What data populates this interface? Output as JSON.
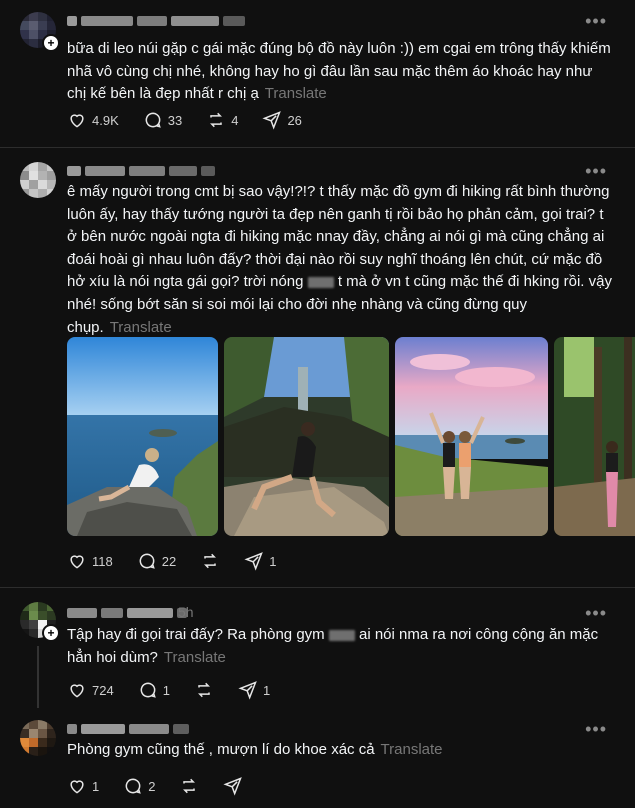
{
  "translate_label": "Translate",
  "posts": [
    {
      "text": "bữa di leo núi gặp c gái mặc đúng bộ đồ này luôn :)) em cgai em trông thấy khiếm nhã vô cùng chị nhé, không hay ho gì đâu lần sau mặc thêm áo khoác hay như chị kế bên là đẹp nhất r chị ạ",
      "likes": "4.9K",
      "comments": "33",
      "reposts": "4",
      "shares": "26"
    },
    {
      "text_part1": "ê mấy người trong cmt bị sao vậy!?!? t thấy mặc đồ gym đi hiking rất bình thường luôn ấy, hay thấy tướng người ta đẹp nên ganh tị rồi bảo họ phản cảm, gọi trai? t ở bên nước ngoài ngta đi hiking mặc nnay đầy, chẳng ai nói gì mà cũng chẳng ai đoái hoài gì nhau luôn đấy? thời đại nào rồi suy nghĩ thoáng lên chút, cứ mặc đồ hở xíu là nói ngta gái gọi? trời nóng",
      "text_part2": "t mà ở vn t cũng mặc thế đi hking rồi. vậy nhé! sống bớt săn si soi mói lại cho đời nhẹ nhàng và cũng đừng quy chụp.",
      "likes": "118",
      "comments": "22",
      "shares": "1"
    },
    {
      "time": "5h",
      "text_part1": "Tập hay đi gọi trai đấy? Ra phòng gym",
      "text_part2": "ai nói nma ra nơi công cộng ăn mặc hẳn hoi dùm?",
      "likes": "724",
      "comments": "1",
      "shares": "1"
    },
    {
      "text": "Phòng gym cũng thế , mượn lí do khoe xác cả",
      "likes": "1",
      "comments": "2"
    }
  ],
  "icons": [
    "heart-icon",
    "comment-icon",
    "repost-icon",
    "share-icon",
    "more-icon"
  ]
}
